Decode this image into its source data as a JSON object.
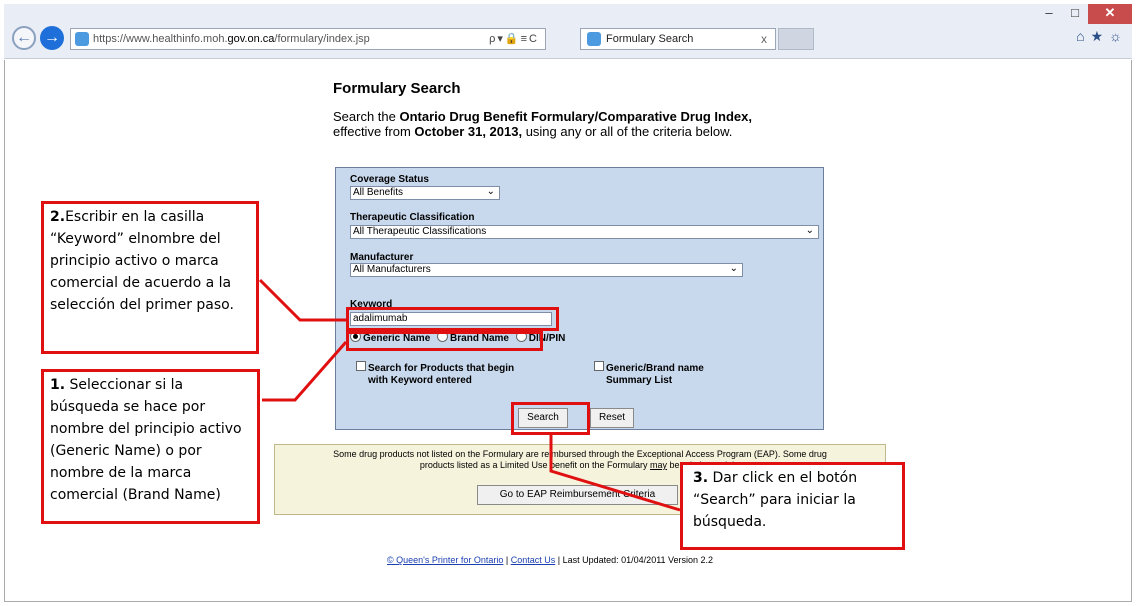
{
  "browser": {
    "url_prefix": "https://www.healthinfo.moh.",
    "url_domain": "gov.on.ca",
    "url_path": "/formulary/index.jsp",
    "addr_tools": "ρ▾🔒≡C",
    "tab_title": "Formulary Search",
    "tab_close": "x",
    "minimize": "–",
    "maximize": "□",
    "close": "✕",
    "right_icons": "⌂★☼"
  },
  "page": {
    "title": "Formulary Search",
    "intro_1": "Search the ",
    "intro_bold_1": "Ontario Drug Benefit Formulary/Comparative Drug Index,",
    "intro_2": "effective from ",
    "intro_bold_2": "October 31, 2013,",
    "intro_3": " using any or all of the criteria below."
  },
  "form": {
    "coverage_label": "Coverage Status",
    "coverage_value": "All Benefits",
    "therapeutic_label": "Therapeutic Classification",
    "therapeutic_value": "All Therapeutic Classifications",
    "manufacturer_label": "Manufacturer",
    "manufacturer_value": "All Manufacturers",
    "keyword_label": "Keyword",
    "keyword_value": "adalimumab",
    "radio_generic": "Generic Name",
    "radio_brand": "Brand Name",
    "radio_din": "DIN/PIN",
    "selected_radio": "Generic Name",
    "chk_begin": "Search for Products that begin with Keyword entered",
    "chk_summary": "Generic/Brand name Summary List",
    "search_btn": "Search",
    "reset_btn": "Reset",
    "chevron": "⌄"
  },
  "eap": {
    "line1": "Some drug products not listed on the Formulary are reimbursed through the Exceptional Access Program (EAP). Some drug",
    "line2_a": "products listed as a Limited Use benefit on the Formulary ",
    "line2_u": "may",
    "line2_b": " be reimbursed thr",
    "button": "Go to EAP Reimbursement Criteria"
  },
  "footer": {
    "printer": "© Queen's Printer for Ontario",
    "sep1": " | ",
    "contact": "Contact Us",
    "rest": " | Last Updated: 01/04/2011 Version 2.2"
  },
  "annotations": {
    "step2_num": "2.",
    "step2_text": "Escribir en la casilla “Keyword” elnombre del principio activo o marca comercial de acuerdo a la selección del primer paso.",
    "step1_num": "1.",
    "step1_text": " Seleccionar si la búsqueda se hace por nombre del principio activo (Generic Name) o por nombre de la marca comercial (Brand Name)",
    "step3_num": "3.",
    "step3_text": " Dar click en el botón “Search” para iniciar la búsqueda.",
    "color": "#e01010"
  }
}
